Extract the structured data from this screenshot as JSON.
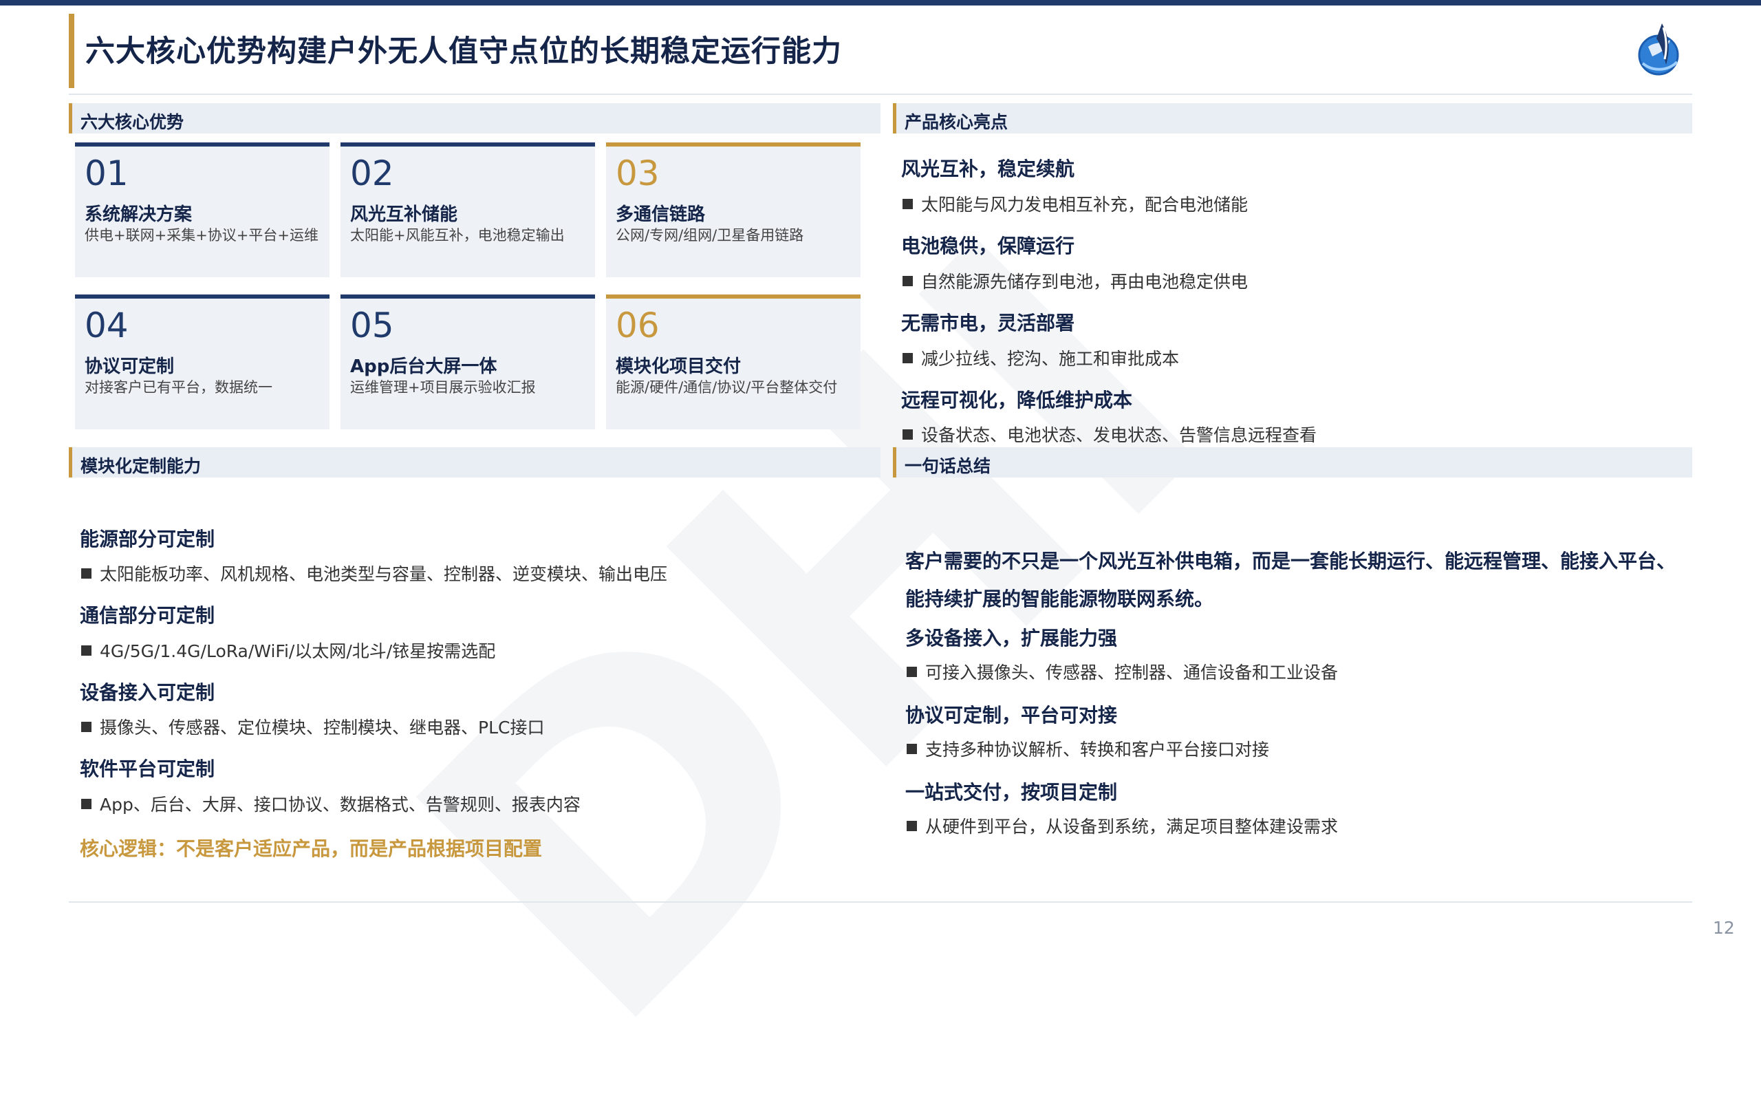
{
  "title": "六大核心优势构建户外无人值守点位的长期稳定运行能力",
  "watermark": "DHI",
  "sections": {
    "advantages": "六大核心优势",
    "highlights": "产品核心亮点",
    "custom": "模块化定制能力",
    "summary": "一句话总结"
  },
  "cards": [
    {
      "num": "01",
      "title": "系统解决方案",
      "desc": "供电+联网+采集+协议+平台+运维"
    },
    {
      "num": "02",
      "title": "风光互补储能",
      "desc": "太阳能+风能互补，电池稳定输出"
    },
    {
      "num": "03",
      "title": "多通信链路",
      "desc": "公网/专网/组网/卫星备用链路"
    },
    {
      "num": "04",
      "title": "协议可定制",
      "desc": "对接客户已有平台，数据统一"
    },
    {
      "num": "05",
      "title": "App后台大屏一体",
      "desc": "运维管理+项目展示验收汇报"
    },
    {
      "num": "06",
      "title": "模块化项目交付",
      "desc": "能源/硬件/通信/协议/平台整体交付"
    }
  ],
  "highlights": [
    {
      "title": "风光互补，稳定续航",
      "text": "太阳能与风力发电相互补充，配合电池储能"
    },
    {
      "title": "电池稳供，保障运行",
      "text": "自然能源先储存到电池，再由电池稳定供电"
    },
    {
      "title": "无需市电，灵活部署",
      "text": "减少拉线、挖沟、施工和审批成本"
    },
    {
      "title": "远程可视化，降低维护成本",
      "text": "设备状态、电池状态、发电状态、告警信息远程查看"
    }
  ],
  "custom": [
    {
      "title": "能源部分可定制",
      "text": "太阳能板功率、风机规格、电池类型与容量、控制器、逆变模块、输出电压"
    },
    {
      "title": "通信部分可定制",
      "text": "4G/5G/1.4G/LoRa/WiFi/以太网/北斗/铱星按需选配"
    },
    {
      "title": "设备接入可定制",
      "text": "摄像头、传感器、定位模块、控制模块、继电器、PLC接口"
    },
    {
      "title": "软件平台可定制",
      "text": "App、后台、大屏、接口协议、数据格式、告警规则、报表内容"
    }
  ],
  "core_logic": "核心逻辑：不是客户适应产品，而是产品根据项目配置",
  "summary": {
    "statement": "客户需要的不只是一个风光互补供电箱，而是一套能长期运行、能远程管理、能接入平台、能持续扩展的智能能源物联网系统。",
    "items": [
      {
        "title": "多设备接入，扩展能力强",
        "text": "可接入摄像头、传感器、控制器、通信设备和工业设备"
      },
      {
        "title": "协议可定制，平台可对接",
        "text": "支持多种协议解析、转换和客户平台接口对接"
      },
      {
        "title": "一站式交付，按项目定制",
        "text": "从硬件到平台，从设备到系统，满足项目整体建设需求"
      }
    ]
  },
  "page_number": "12"
}
